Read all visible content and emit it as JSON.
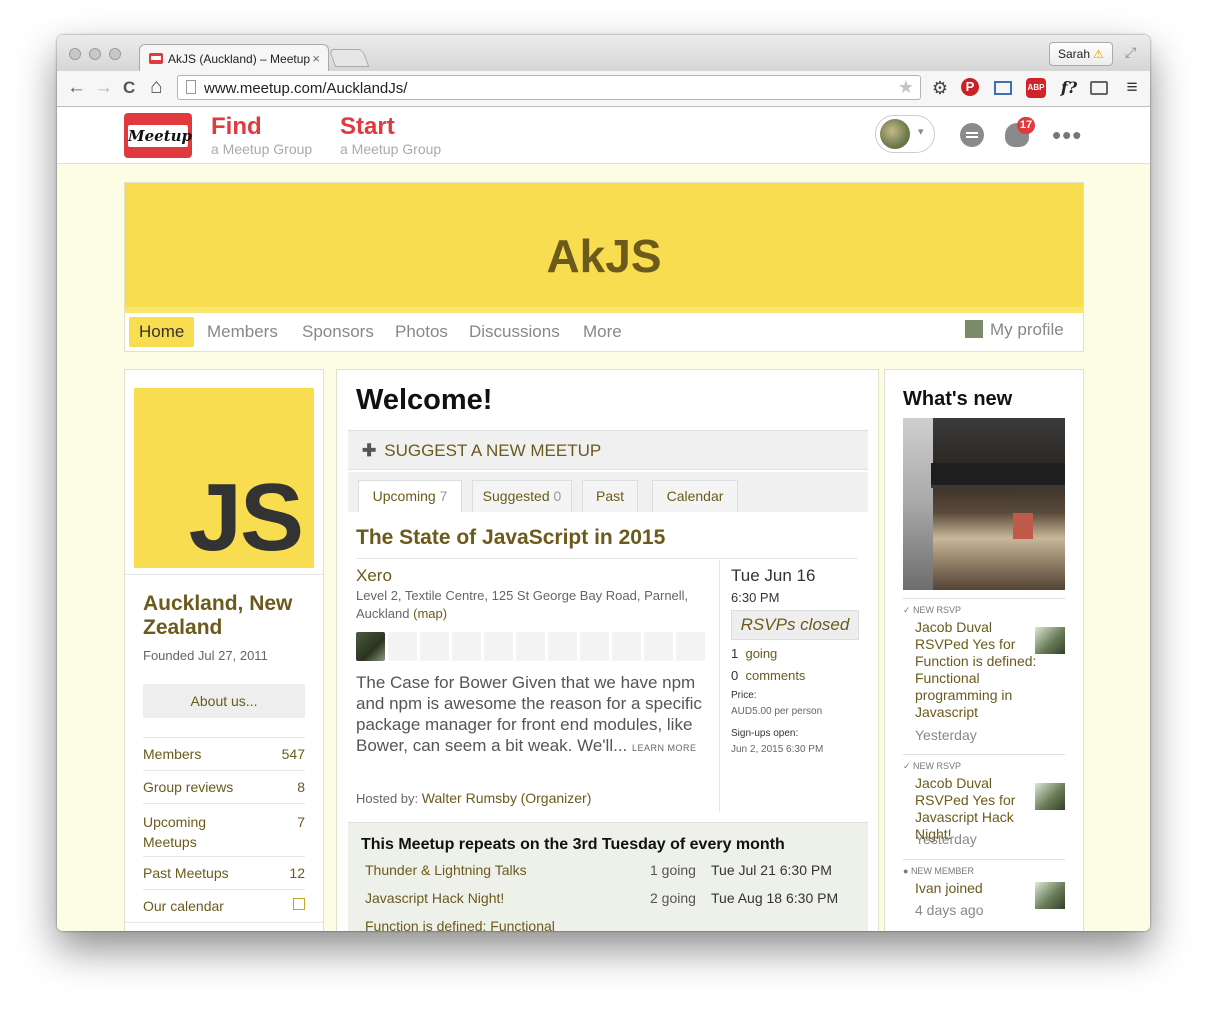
{
  "browser": {
    "tab_title": "AkJS (Auckland) – Meetup",
    "tab_close": "×",
    "user_label": "Sarah",
    "url": "www.meetup.com/AucklandJs/",
    "nav": {
      "back": "←",
      "forward": "→",
      "reload": "C",
      "home": "⌂"
    },
    "ext_icons": [
      "gear-icon",
      "pinterest-icon",
      "screen-capture-icon",
      "adblock-icon",
      "f-question-icon",
      "cast-icon",
      "menu-icon"
    ]
  },
  "site": {
    "logo_text": "Meetup",
    "find_label": "Find",
    "find_sub": "a Meetup Group",
    "start_label": "Start",
    "start_sub": "a Meetup Group",
    "notification_count": "17",
    "more_dots": "•••"
  },
  "group": {
    "name": "AkJS",
    "nav": [
      "Home",
      "Members",
      "Sponsors",
      "Photos",
      "Discussions",
      "More"
    ],
    "my_profile": "My profile",
    "logo_text": "JS",
    "city": "Auckland, New Zealand",
    "founded": "Founded Jul 27, 2011",
    "about_label": "About us...",
    "stats": [
      {
        "label": "Members",
        "value": "547"
      },
      {
        "label": "Group reviews",
        "value": "8"
      },
      {
        "label": "Upcoming Meetups",
        "value": "7"
      },
      {
        "label": "Past Meetups",
        "value": "12"
      },
      {
        "label": "Our calendar",
        "value": ""
      }
    ]
  },
  "main": {
    "welcome": "Welcome!",
    "suggest_label": "SUGGEST A NEW MEETUP",
    "tabs": [
      {
        "label": "Upcoming",
        "count": "7"
      },
      {
        "label": "Suggested",
        "count": "0"
      },
      {
        "label": "Past",
        "count": ""
      },
      {
        "label": "Calendar",
        "count": ""
      }
    ],
    "event": {
      "title": "The State of JavaScript in 2015",
      "venue": "Xero",
      "address": "Level 2, Textile Centre, 125 St George Bay Road, Parnell, Auckland",
      "map_label": "(map)",
      "description": "The Case for Bower Given that we have npm and npm is awesome the reason for a specific package manager for front end modules, like Bower, can seem a bit weak. We'll...",
      "learn_more": "LEARN MORE",
      "hosted_prefix": "Hosted by:",
      "host_name": "Walter Rumsby",
      "host_role": "(Organizer)",
      "date": "Tue Jun 16",
      "time": "6:30 PM",
      "rsvp_status": "RSVPs closed",
      "going_count": "1",
      "going_label": "going",
      "comments_count": "0",
      "comments_label": "comments",
      "price_label": "Price:",
      "price_value": "AUD5.00 per person",
      "signups_label": "Sign-ups open:",
      "signups_value": "Jun 2, 2015 6:30 PM"
    },
    "repeat": {
      "title": "This Meetup repeats on the 3rd Tuesday of every month",
      "rows": [
        {
          "name": "Thunder & Lightning Talks",
          "going": "1 going",
          "date": "Tue Jul 21 6:30 PM"
        },
        {
          "name": "Javascript Hack Night!",
          "going": "2 going",
          "date": "Tue Aug 18 6:30 PM"
        },
        {
          "name": "Function is defined: Functional",
          "going": "",
          "date": ""
        }
      ]
    }
  },
  "whats_new": {
    "title": "What's new",
    "items": [
      {
        "type": "NEW RSVP",
        "text": "Jacob Duval RSVPed Yes for Function is defined: Functional programming in Javascript",
        "when": "Yesterday"
      },
      {
        "type": "NEW RSVP",
        "text": "Jacob Duval RSVPed Yes for Javascript Hack Night!",
        "when": "Yesterday"
      },
      {
        "type": "NEW MEMBER",
        "text": "Ivan joined",
        "when": "4 days ago"
      }
    ]
  }
}
